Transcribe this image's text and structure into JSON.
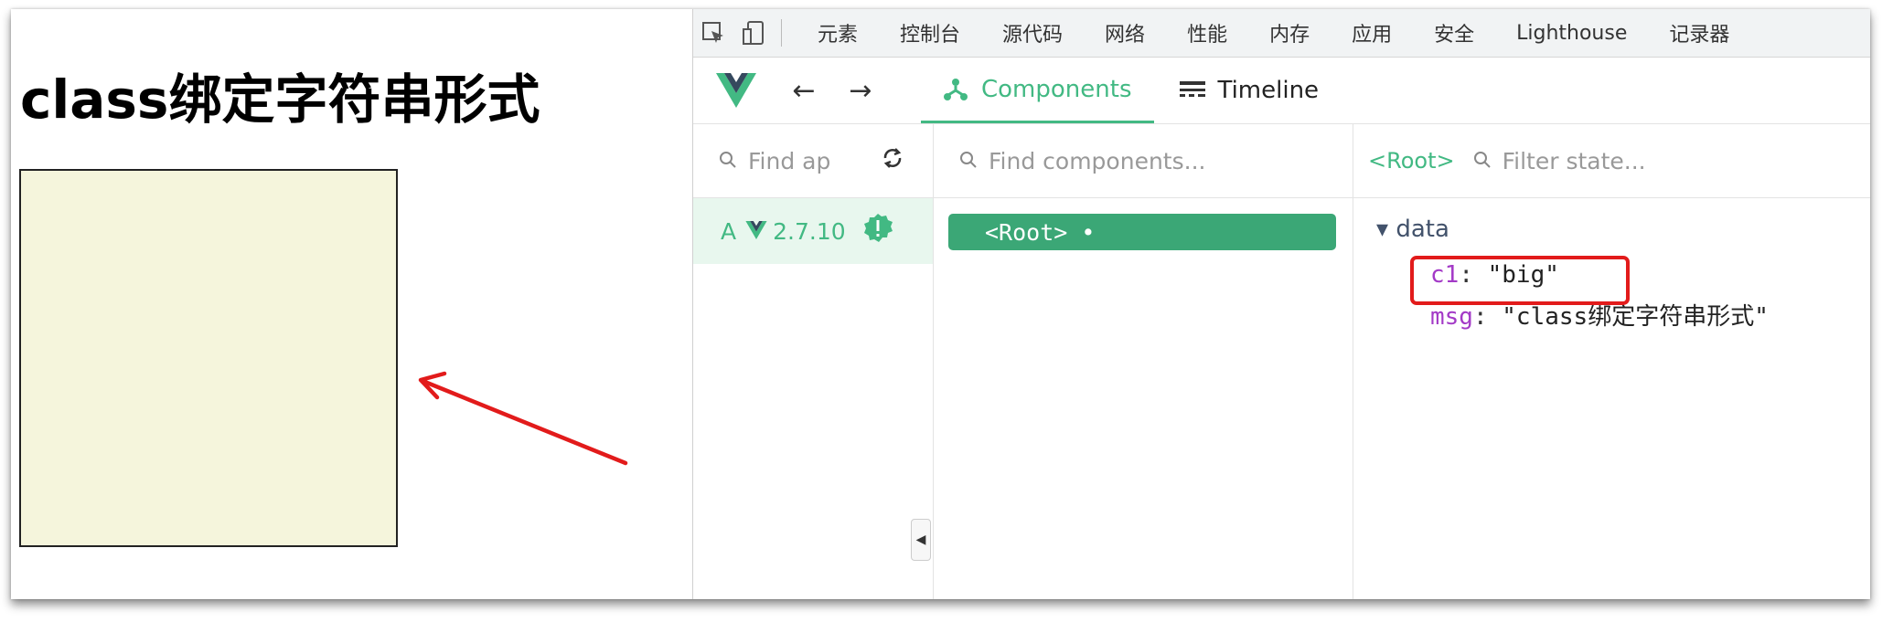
{
  "page": {
    "title": "class绑定字符串形式"
  },
  "devtools": {
    "top_tabs": [
      "元素",
      "控制台",
      "源代码",
      "网络",
      "性能",
      "内存",
      "应用",
      "安全",
      "Lighthouse",
      "记录器"
    ],
    "vue_tabs": {
      "components": "Components",
      "timeline": "Timeline"
    },
    "apps_panel": {
      "search_placeholder": "Find ap",
      "app_letter": "A",
      "version": "2.7.10"
    },
    "components_panel": {
      "search_placeholder": "Find components...",
      "root_label": "<Root> •"
    },
    "state_panel": {
      "root_tag": "<Root>",
      "filter_placeholder": "Filter state...",
      "section_label": "▾ data",
      "entries": [
        {
          "key": "c1",
          "value": "\"big\""
        },
        {
          "key": "msg",
          "value": "\"class绑定字符串形式\""
        }
      ]
    }
  },
  "colors": {
    "vue_green": "#42b983",
    "box_fill": "#f5f5dc",
    "annotation_red": "#e21b1b"
  }
}
